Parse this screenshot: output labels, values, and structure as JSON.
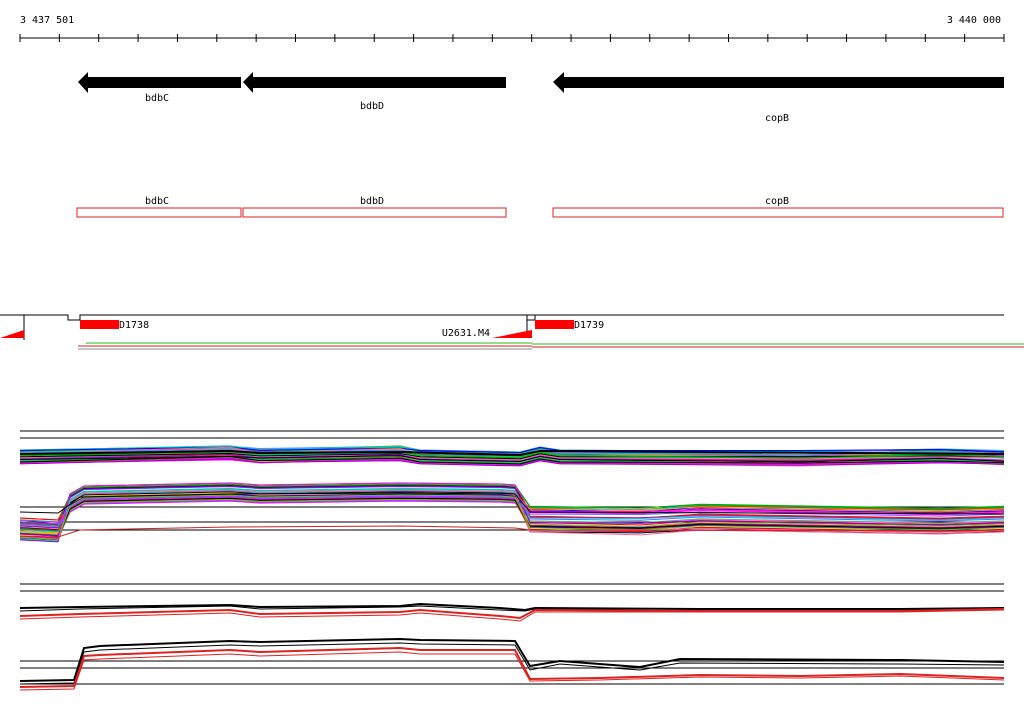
{
  "ruler": {
    "start_label": "3 437 501",
    "end_label": "3 440 000"
  },
  "genes": [
    {
      "name": "bdbC",
      "strand": "-"
    },
    {
      "name": "bdbD",
      "strand": "-"
    },
    {
      "name": "copB",
      "strand": "-"
    }
  ],
  "promoters": [
    {
      "label": "D1738"
    },
    {
      "label": "D1739"
    },
    {
      "label": "U2631.M4"
    }
  ],
  "colors": {
    "gene_arrow": "#000000",
    "cds_box": "#dd2222",
    "promoter": "#ff0000",
    "axis": "#000000"
  }
}
